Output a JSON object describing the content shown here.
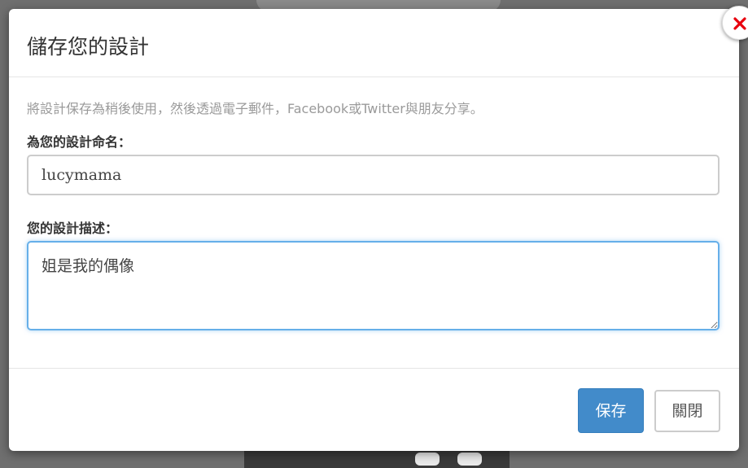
{
  "dialog": {
    "title": "儲存您的設計",
    "description": "將設計保存為稍後使用，然後透過電子郵件，Facebook或Twitter與朋友分享。",
    "close_icon": "close-icon"
  },
  "form": {
    "name_label": "為您的設計命名：",
    "name_value": "lucymama",
    "description_label": "您的設計描述：",
    "description_value": "姐是我的偶像"
  },
  "footer": {
    "save_label": "保存",
    "close_label": "關閉"
  },
  "colors": {
    "primary_button": "#428bca",
    "close_icon": "#e8000d",
    "focus_border": "#66afe9"
  }
}
